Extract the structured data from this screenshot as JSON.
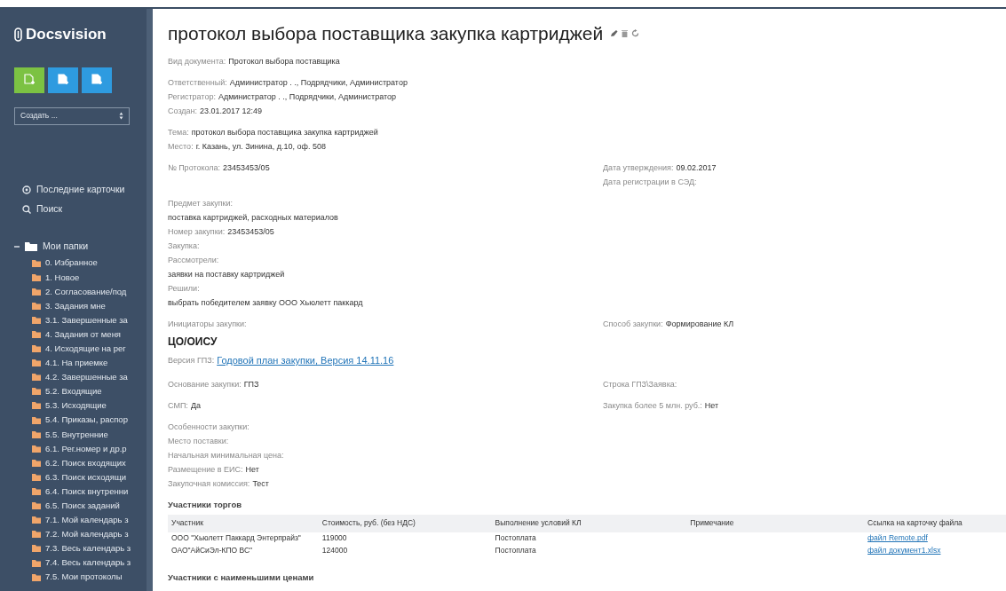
{
  "sidebar": {
    "logo": "Docsvision",
    "create_buttons": [
      {
        "color": "#7cc243"
      },
      {
        "color": "#2e9be0"
      },
      {
        "color": "#2e9be0"
      }
    ],
    "create_select": {
      "value": "Создать ..."
    },
    "nav": [
      {
        "kind": "recent",
        "label": "Последние карточки"
      },
      {
        "kind": "search",
        "label": "Поиск"
      }
    ],
    "tree": {
      "label": "Мои папки",
      "expanded": true,
      "children": [
        {
          "label": "0. Избранное"
        },
        {
          "label": "1. Новое"
        },
        {
          "label": "2. Согласование/под"
        },
        {
          "label": "3. Задания мне"
        },
        {
          "label": "3.1. Завершенные за"
        },
        {
          "label": "4. Задания от меня"
        },
        {
          "label": "4. Исходящие на рег"
        },
        {
          "label": "4.1. На приемке"
        },
        {
          "label": "4.2. Завершенные за"
        },
        {
          "label": "5.2. Входящие"
        },
        {
          "label": "5.3. Исходящие"
        },
        {
          "label": "5.4. Приказы, распор"
        },
        {
          "label": "5.5. Внутренние"
        },
        {
          "label": "6.1. Рег.номер и др.р"
        },
        {
          "label": "6.2. Поиск входящих"
        },
        {
          "label": "6.3. Поиск исходящи"
        },
        {
          "label": "6.4. Поиск внутренни"
        },
        {
          "label": "6.5. Поиск заданий"
        },
        {
          "label": "7.1. Мой календарь з"
        },
        {
          "label": "7.2. Мой календарь з"
        },
        {
          "label": "7.3. Весь календарь з"
        },
        {
          "label": "7.4. Весь календарь з"
        },
        {
          "label": "7.5. Мои протоколы"
        }
      ]
    }
  },
  "document": {
    "title": "протокол выбора поставщика закупка картриджей",
    "blocks": [
      {
        "left": [
          {
            "kind": "field",
            "label": "Вид документа:",
            "value": "Протокол выбора поставщика"
          }
        ]
      },
      {
        "left": [
          {
            "kind": "field",
            "label": "Ответственный:",
            "value": "Администратор . ., Подрядчики, Администратор"
          },
          {
            "kind": "field",
            "label": "Регистратор:",
            "value": "Администратор . ., Подрядчики, Администратор"
          },
          {
            "kind": "field",
            "label": "Создан:",
            "value": "23.01.2017 12:49"
          }
        ]
      },
      {
        "left": [
          {
            "kind": "field",
            "label": "Тема:",
            "value": "протокол выбора поставщика закупка картриджей"
          },
          {
            "kind": "field",
            "label": "Место:",
            "value": "г. Казань, ул. Зинина, д.10, оф. 508"
          }
        ]
      },
      {
        "left": [
          {
            "kind": "field",
            "label": "№ Протокола:",
            "value": "23453453/05"
          }
        ],
        "right": [
          {
            "kind": "field",
            "label": "Дата утверждения:",
            "value": "09.02.2017"
          },
          {
            "kind": "field",
            "label": "Дата регистрации в СЭД:"
          }
        ]
      },
      {
        "left": [
          {
            "kind": "field",
            "label": "Предмет закупки:"
          },
          {
            "kind": "text",
            "value": "поставка картриджей, расходных материалов"
          },
          {
            "kind": "field",
            "label": "Номер закупки:",
            "value": "23453453/05"
          },
          {
            "kind": "field",
            "label": "Закупка:"
          },
          {
            "kind": "field",
            "label": "Рассмотрели:"
          },
          {
            "kind": "text",
            "value": "заявки на поставку картриджей"
          },
          {
            "kind": "field",
            "label": "Решили:"
          },
          {
            "kind": "text",
            "value": "выбрать победителем заявку ООО Хьюлетт паккард"
          }
        ]
      },
      {
        "left": [
          {
            "kind": "field",
            "label": "Инициаторы закупки:"
          },
          {
            "kind": "strong",
            "value": "ЦО/ОИСУ"
          },
          {
            "kind": "link",
            "label": "Версия ГПЗ:",
            "value": "Годовой план закупки, Версия 14.11.16"
          }
        ],
        "right": [
          {
            "kind": "field",
            "label": "Способ закупки:",
            "value": "Формирование КЛ"
          }
        ]
      },
      {
        "left": [
          {
            "kind": "field",
            "label": "Основание закупки:",
            "value": "ГПЗ"
          }
        ],
        "right": [
          {
            "kind": "field",
            "label": "Строка ГПЗ\\Заявка:"
          }
        ]
      },
      {
        "left": [
          {
            "kind": "field",
            "label": "СМП:",
            "value": "Да"
          }
        ],
        "right": [
          {
            "kind": "field",
            "label": "Закупка более 5 млн. руб.:",
            "value": "Нет"
          }
        ]
      },
      {
        "left": [
          {
            "kind": "field",
            "label": "Особенности закупки:"
          },
          {
            "kind": "field",
            "label": "Место поставки:"
          },
          {
            "kind": "field",
            "label": "Начальная минимальная цена:"
          },
          {
            "kind": "field",
            "label": "Размещение в ЕИС:",
            "value": "Нет"
          },
          {
            "kind": "field",
            "label": "Закупочная комиссия:",
            "value": "Тест"
          }
        ]
      }
    ],
    "participants": {
      "title": "Участники торгов",
      "columns": [
        "Участник",
        "Стоимость, руб. (без НДС)",
        "Выполнение условий КЛ",
        "Примечание",
        "Ссылка на карточку файла"
      ],
      "rows": [
        [
          "ООО \"Хьюлетт Паккард Энтерпрайз\"",
          "119000",
          "Постоплата",
          "",
          "файл Remote.pdf"
        ],
        [
          "ОАО\"АйСиЭл-КПО ВС\"",
          "124000",
          "Постоплата",
          "",
          "файл документ1.xlsx"
        ]
      ]
    },
    "next_section": "Участники с наименьшими ценами"
  }
}
